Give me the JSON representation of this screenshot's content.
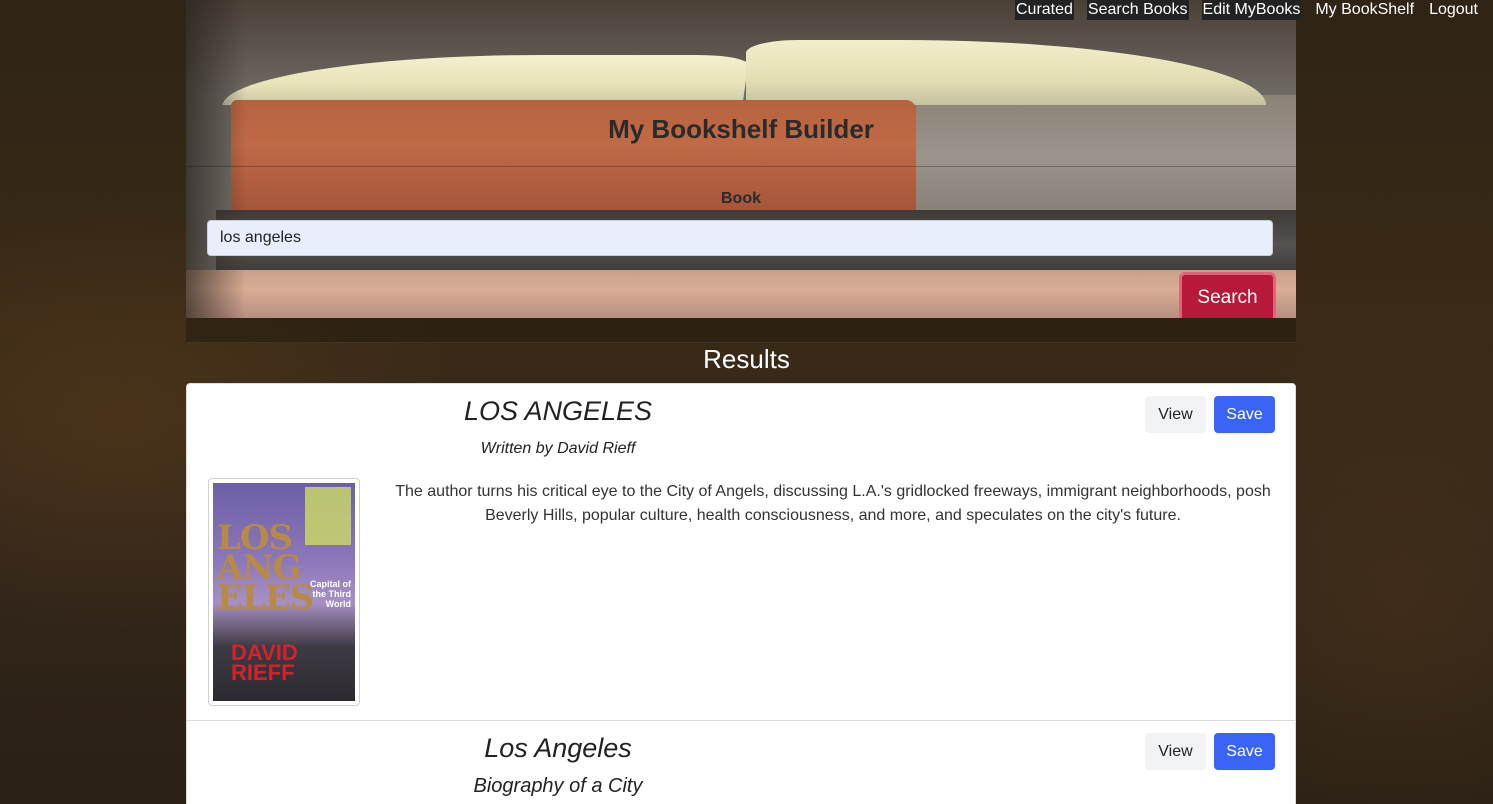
{
  "nav": {
    "items": [
      {
        "label": "Curated"
      },
      {
        "label": "Search Books"
      },
      {
        "label": "Edit MyBooks"
      },
      {
        "label": "My BookShelf"
      },
      {
        "label": "Logout"
      }
    ]
  },
  "header": {
    "title": "My Bookshelf Builder",
    "field_label": "Book",
    "search_value": "los angeles",
    "search_button": "Search"
  },
  "results": {
    "heading": "Results",
    "items": [
      {
        "title": "LOS ANGELES",
        "subtitle": "Written by David Rieff",
        "description": "The author turns his critical eye to the City of Angels, discussing L.A.'s gridlocked freeways, immigrant neighborhoods, posh Beverly Hills, popular culture, health consciousness, and more, and speculates on the city's future.",
        "view_label": "View",
        "save_label": "Save",
        "cover": {
          "title_text": "LOS ANGELES",
          "subtitle_text": "Capital of the Third World",
          "author_text": "DAVID RIEFF"
        }
      },
      {
        "title": "Los Angeles",
        "subtitle": "Biography of a City",
        "view_label": "View",
        "save_label": "Save"
      }
    ]
  },
  "colors": {
    "search_button": "#b7193a",
    "save_button": "#3a64f5",
    "view_button": "#f2f3f5"
  }
}
